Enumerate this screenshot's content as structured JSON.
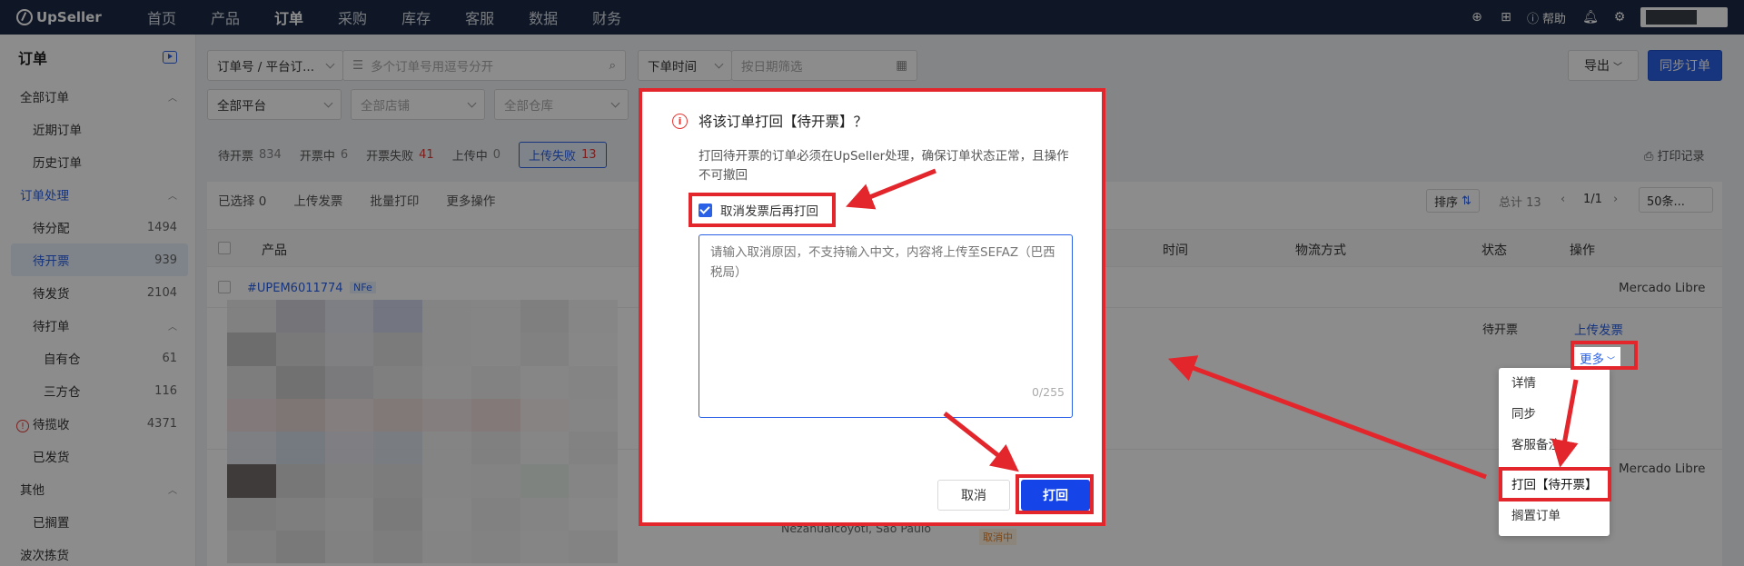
{
  "topbar": {
    "logo": "UpSeller",
    "nav": [
      "首页",
      "产品",
      "订单",
      "采购",
      "库存",
      "客服",
      "数据",
      "财务"
    ],
    "active_nav": "订单",
    "help": "帮助"
  },
  "sidebar": {
    "title": "订单",
    "items": [
      {
        "label": "全部订单",
        "level": 1
      },
      {
        "label": "近期订单",
        "level": 2
      },
      {
        "label": "历史订单",
        "level": 2
      },
      {
        "label": "订单处理",
        "level": 1
      },
      {
        "label": "待分配",
        "level": 2,
        "count": "1494"
      },
      {
        "label": "待开票",
        "level": 2,
        "count": "939"
      },
      {
        "label": "待发货",
        "level": 2,
        "count": "2104"
      },
      {
        "label": "待打单",
        "level": 2
      },
      {
        "label": "自有仓",
        "level": 3,
        "count": "61"
      },
      {
        "label": "三方仓",
        "level": 3,
        "count": "116"
      },
      {
        "label": "待揽收",
        "level": 2,
        "count": "4371"
      },
      {
        "label": "已发货",
        "level": 2
      },
      {
        "label": "其他",
        "level": 1
      },
      {
        "label": "已搁置",
        "level": 2
      },
      {
        "label": "波次拣货",
        "level": 1
      }
    ]
  },
  "filters": {
    "order_type": "订单号 / 平台订...",
    "search_placeholder": "多个订单号用逗号分开",
    "time_type": "下单时间",
    "date_placeholder": "按日期筛选",
    "platform": "全部平台",
    "store": "全部店铺",
    "warehouse": "全部仓库",
    "export": "导出",
    "sync": "同步订单"
  },
  "tabs": [
    {
      "label": "待开票",
      "count": "834"
    },
    {
      "label": "开票中",
      "count": "6"
    },
    {
      "label": "开票失败",
      "count": "41"
    },
    {
      "label": "上传中",
      "count": "0"
    },
    {
      "label": "上传失败",
      "count": "13"
    }
  ],
  "print_record": "打印记录",
  "toolbar": {
    "selected": "已选择 0",
    "upload_invoice": "上传发票",
    "batch_print": "批量打印",
    "more_ops": "更多操作",
    "sort": "排序",
    "total": "总计 13",
    "page": "1/1",
    "per_page": "50条..."
  },
  "table": {
    "headers": [
      "产品",
      "时间",
      "物流方式",
      "状态",
      "操作"
    ],
    "row1": {
      "order_no": "#UPEM6011774",
      "badge": "NFe",
      "platform": "Mercado Libre",
      "status": "待开票",
      "action": "上传发票",
      "more": "更多"
    },
    "row2": {
      "platform": "Mercado Libre",
      "status_tag": "取消中",
      "address": "Nezahualcoyotl, Sao Paulo"
    }
  },
  "modal": {
    "title": "将该订单打回【待开票】？",
    "desc": "打回待开票的订单必须在UpSeller处理，确保订单状态正常，且操作不可撤回",
    "checkbox": "取消发票后再打回",
    "textarea_placeholder": "请输入取消原因，不支持输入中文，内容将上传至SEFAZ（巴西税局）",
    "counter": "0/255",
    "cancel": "取消",
    "ok": "打回"
  },
  "more_menu": [
    "详情",
    "同步",
    "客服备注",
    "打回【待开票】",
    "搁置订单"
  ],
  "colors": {
    "accent": "#2a61e6",
    "highlight": "#e3262c",
    "topbar": "#1d2b45"
  }
}
